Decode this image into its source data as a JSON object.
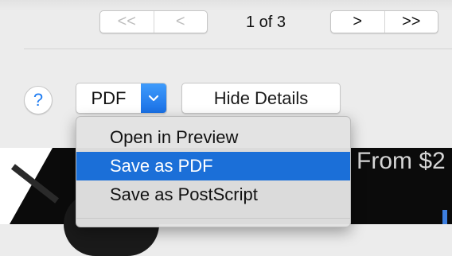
{
  "pagination": {
    "first_label": "<<",
    "prev_label": "<",
    "page_indicator": "1 of 3",
    "next_label": ">",
    "last_label": ">>"
  },
  "help_label": "?",
  "pdf_button": {
    "label": "PDF"
  },
  "hide_details_label": "Hide Details",
  "pdf_menu": {
    "items": [
      {
        "label": "Open in Preview",
        "selected": false
      },
      {
        "label": "Save as PDF",
        "selected": true
      },
      {
        "label": "Save as PostScript",
        "selected": false
      }
    ]
  },
  "preview": {
    "text": "From $2"
  },
  "colors": {
    "accent": "#1b6fd8",
    "help_icon": "#1e7cf2"
  },
  "icons": {
    "dropdown_arrow": "chevron-down-icon"
  }
}
